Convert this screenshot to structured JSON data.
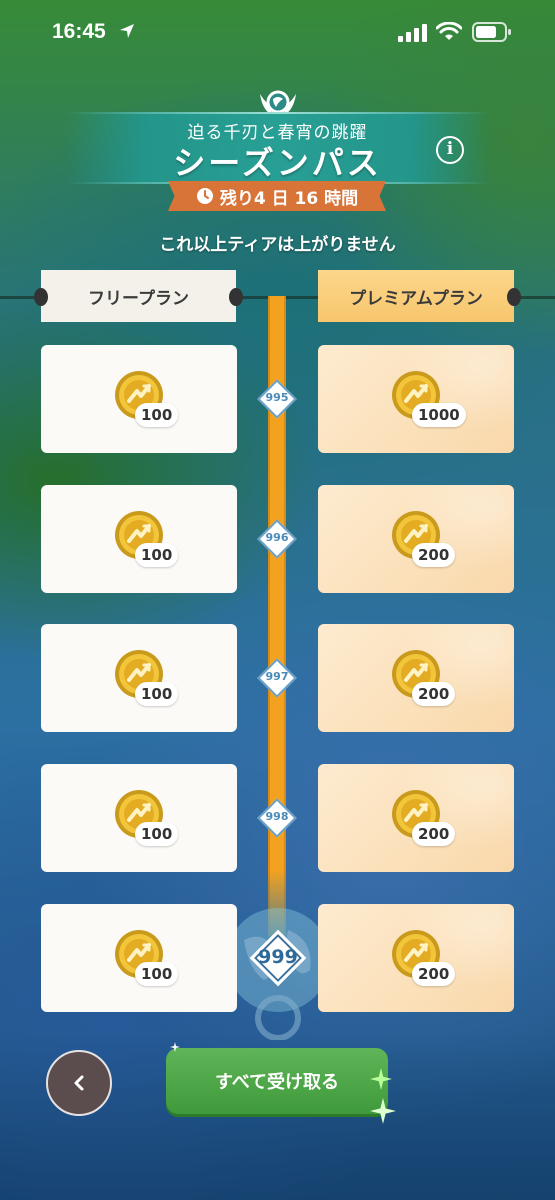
{
  "status_bar": {
    "time": "16:45"
  },
  "header": {
    "subtitle": "迫る千刃と春宵の跳躍",
    "title": "シーズンパス",
    "timer": "残り4 日 16 時間",
    "notice": "これ以上ティアは上がりません"
  },
  "plans": {
    "free_label": "フリープラン",
    "premium_label": "プレミアムプラン"
  },
  "tiers": [
    {
      "tier": "995",
      "free_amount": "100",
      "premium_amount": "1000"
    },
    {
      "tier": "996",
      "free_amount": "100",
      "premium_amount": "200"
    },
    {
      "tier": "997",
      "free_amount": "100",
      "premium_amount": "200"
    },
    {
      "tier": "998",
      "free_amount": "100",
      "premium_amount": "200"
    },
    {
      "tier": "999",
      "free_amount": "100",
      "premium_amount": "200"
    }
  ],
  "actions": {
    "back_label": "‹",
    "claim_all_label": "すべて受け取る"
  },
  "colors": {
    "rail": "#f3a21f",
    "timer": "#d97438",
    "claim_button": "#4aa545",
    "premium_header": "#f9cf7c"
  },
  "icons": [
    "location-arrow-icon",
    "signal-icon",
    "wifi-icon",
    "battery-icon",
    "crest-icon",
    "info-icon",
    "clock-icon",
    "coin-icon",
    "back-icon",
    "sparkle-icon"
  ]
}
